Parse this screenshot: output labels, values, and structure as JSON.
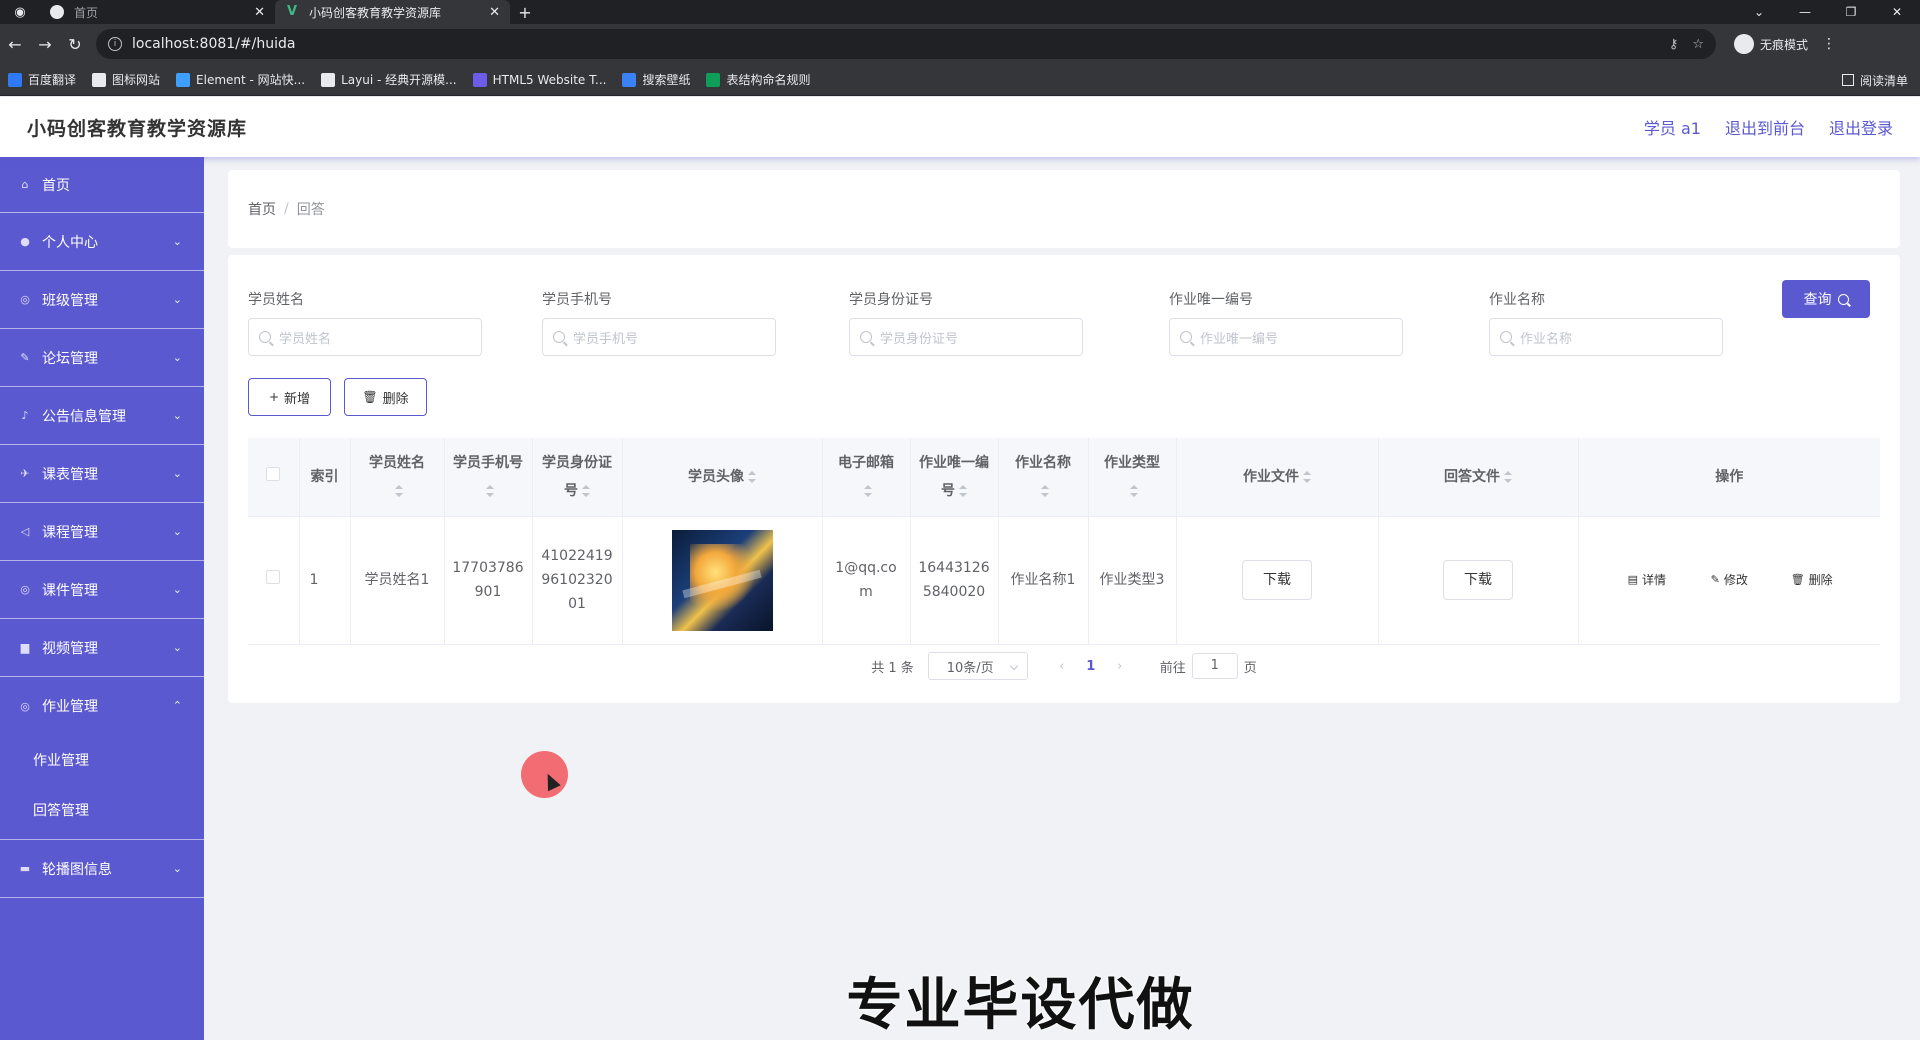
{
  "browser": {
    "tabs": [
      {
        "title": "首页",
        "active": false
      },
      {
        "title": "小码创客教育教学资源库",
        "active": true
      }
    ],
    "url": "localhost:8081/#/huida",
    "profile_label": "无痕模式",
    "bookmarks": [
      {
        "label": "百度翻译",
        "color": "#2f7bf5"
      },
      {
        "label": "图标网站",
        "color": "#e8eaed"
      },
      {
        "label": "Element - 网站快...",
        "color": "#409eff"
      },
      {
        "label": "Layui - 经典开源模...",
        "color": "#e8eaed"
      },
      {
        "label": "HTML5 Website T...",
        "color": "#6c5ce7"
      },
      {
        "label": "搜索壁纸",
        "color": "#3b82f6"
      },
      {
        "label": "表结构命名规则",
        "color": "#0f9d58"
      }
    ],
    "reading_list": "阅读清单"
  },
  "header": {
    "title": "小码创客教育教学资源库",
    "user": "学员 a1",
    "front": "退出到前台",
    "logout": "退出登录"
  },
  "sidebar": {
    "items": [
      {
        "label": "首页",
        "icon": "home-icon",
        "glyph": "⌂"
      },
      {
        "label": "个人中心",
        "icon": "user-icon",
        "glyph": "●"
      },
      {
        "label": "班级管理",
        "icon": "class-icon",
        "glyph": "◎"
      },
      {
        "label": "论坛管理",
        "icon": "forum-icon",
        "glyph": "✎"
      },
      {
        "label": "公告信息管理",
        "icon": "notice-icon",
        "glyph": "♪"
      },
      {
        "label": "课表管理",
        "icon": "schedule-icon",
        "glyph": "✈"
      },
      {
        "label": "课程管理",
        "icon": "course-icon",
        "glyph": "◁"
      },
      {
        "label": "课件管理",
        "icon": "courseware-icon",
        "glyph": "◎"
      },
      {
        "label": "视频管理",
        "icon": "video-icon",
        "glyph": "▆"
      },
      {
        "label": "作业管理",
        "icon": "homework-icon",
        "glyph": "◎"
      }
    ],
    "submenu": [
      "作业管理",
      "回答管理"
    ],
    "last": {
      "label": "轮播图信息",
      "icon": "carousel-icon",
      "glyph": "▬"
    }
  },
  "breadcrumb": {
    "home": "首页",
    "current": "回答"
  },
  "filters": [
    {
      "label": "学员姓名",
      "placeholder": "学员姓名"
    },
    {
      "label": "学员手机号",
      "placeholder": "学员手机号"
    },
    {
      "label": "学员身份证号",
      "placeholder": "学员身份证号"
    },
    {
      "label": "作业唯一编号",
      "placeholder": "作业唯一编号"
    },
    {
      "label": "作业名称",
      "placeholder": "作业名称"
    }
  ],
  "actions": {
    "query": "查询",
    "add": "新增",
    "delete": "删除"
  },
  "table": {
    "headers": [
      "索引",
      "学员姓名",
      "学员手机号",
      "学员身份证号",
      "学员头像",
      "电子邮箱",
      "作业唯一编号",
      "作业名称",
      "作业类型",
      "作业文件",
      "回答文件",
      "操作"
    ],
    "rows": [
      {
        "index": "1",
        "name": "学员姓名1",
        "phone": "17703786901",
        "idcard": "410224199610232001",
        "email": "1@qq.com",
        "hw_no": "164431265840020",
        "hw_name": "作业名称1",
        "hw_type": "作业类型3",
        "hw_file": "下载",
        "ans_file": "下载",
        "detail": "详情",
        "edit": "修改",
        "remove": "删除"
      }
    ]
  },
  "pager": {
    "total": "共 1 条",
    "size": "10条/页",
    "page": "1",
    "goto": "前往",
    "goto_value": "1",
    "unit": "页"
  },
  "watermark": "专业毕设代做",
  "colors": {
    "primary": "#5b59d0",
    "cursor": "#f26c74"
  }
}
